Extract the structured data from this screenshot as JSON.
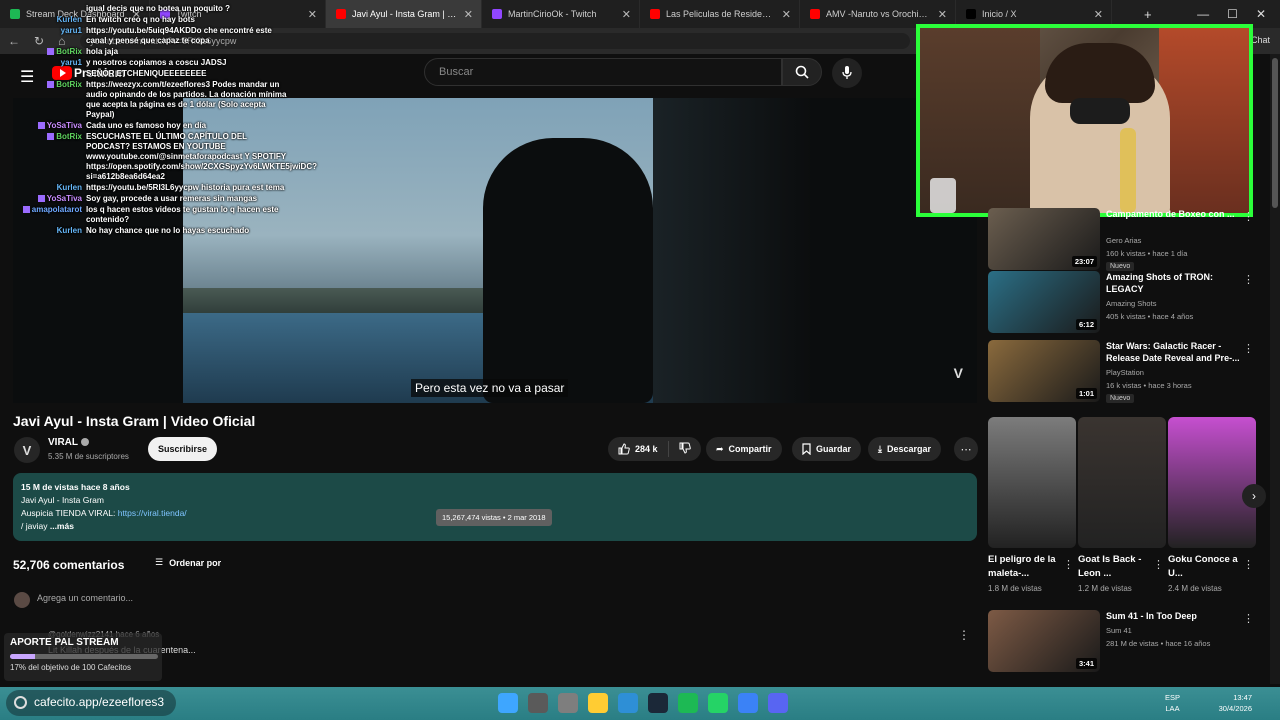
{
  "browser": {
    "tabs": [
      {
        "label": "Stream Deck Dashboard",
        "active": false,
        "fav_color": "#1db954"
      },
      {
        "label": "Twitch",
        "active": false,
        "fav_color": "#9146ff"
      },
      {
        "label": "Javi Ayul - Insta Gram | Video",
        "active": true,
        "fav_color": "#ff0000"
      },
      {
        "label": "MartinCirioOk - Twitch",
        "active": false,
        "fav_color": "#9146ff"
      },
      {
        "label": "Las Peliculas de Resident Evil NO",
        "active": false,
        "fav_color": "#ff0000"
      },
      {
        "label": "AMV -Naruto vs Orochimaru - In",
        "active": false,
        "fav_color": "#ff0000"
      },
      {
        "label": "Inicio / X",
        "active": false,
        "fav_color": "#000000"
      }
    ],
    "url": "youtube.com/watch?v=5RI3L6yycpw",
    "side_label": "Chat"
  },
  "header": {
    "brand": "Premium",
    "search_placeholder": "Buscar"
  },
  "video": {
    "caption": "Pero esta vez no va a pasar",
    "watermark": "V",
    "title": "Javi Ayul - Insta Gram | Video Oficial"
  },
  "channel": {
    "avatar_letter": "V",
    "name": "VIRAL",
    "subs": "5.35 M de suscriptores",
    "subscribe_label": "Suscribirse"
  },
  "actions": {
    "likes": "284 k",
    "share": "Compartir",
    "save": "Guardar",
    "download": "Descargar"
  },
  "description": {
    "meta": "15 M de vistas  hace 8 años",
    "line1": "Javi Ayul - Insta Gram",
    "line2_prefix": "Auspicia TIENDA VIRAL: ",
    "line2_link": "https://viral.tienda/",
    "line3_prefix": "/ javiay",
    "more": "...más",
    "tooltip": "15,267,474 vistas • 2 mar 2018"
  },
  "comments": {
    "count": "52,706 comentarios",
    "sort_label": "Ordenar por",
    "add_placeholder": "Agrega un comentario...",
    "first_user": "@goldenwizz2141  hace 6 años",
    "first_text": "Lit Killah después de la cuarentena..."
  },
  "chat": [
    {
      "user": "",
      "text": "igual decis que no botea un poquito ?",
      "color": "#ffffff",
      "badge": false
    },
    {
      "user": "Kurlen",
      "text": "En twitch creo q no hay bots",
      "color": "#64b5f6",
      "badge": false
    },
    {
      "user": "yaru1",
      "text": "https://youtu.be/5uiq94AKDDo che encontré este canal y pensé que capaz te copa",
      "color": "#64b5f6",
      "badge": false
    },
    {
      "user": "BotRix",
      "text": "hola jaja",
      "color": "#5fd35f",
      "badge": true
    },
    {
      "user": "yaru1",
      "text": "y nosotros copiamos a coscu JADSJ",
      "color": "#64b5f6",
      "badge": false
    },
    {
      "user": "",
      "text": "SEÑOR ETCHENIQUEEEEEEEE",
      "color": "#ffffff",
      "badge": false
    },
    {
      "user": "BotRix",
      "text": "https://weezyx.com/t/ezeeflores3 Podes mandar un audio opinando de los partidos. La donación mínima que acepta la página es de 1 dólar (Solo acepta Paypal)",
      "color": "#5fd35f",
      "badge": true
    },
    {
      "user": "YoSaTiva",
      "text": "Cada uno es famoso hoy en día",
      "color": "#c98cff",
      "badge": true
    },
    {
      "user": "BotRix",
      "text": "ESCUCHASTE EL ÚLTIMO CAPÍTULO DEL PODCAST? ESTAMOS EN YOUTUBE www.youtube.com/@sinmetaforapodcast Y SPOTIFY https://open.spotify.com/show/2CXGSpyzYv6LWKTE5jwiDC?si=a612b8ea6d64ea2",
      "color": "#5fd35f",
      "badge": true
    },
    {
      "user": "Kurlen",
      "text": "https://youtu.be/5RI3L6yycpw historia pura est tema",
      "color": "#64b5f6",
      "badge": false
    },
    {
      "user": "YoSaTiva",
      "text": "Soy gay, procede a usar remeras sin mangas",
      "color": "#c98cff",
      "badge": true
    },
    {
      "user": "amapolatarot",
      "text": "los q hacen estos videos te gustan lo q hacen este contenido?",
      "color": "#6ea8ff",
      "badge": true
    },
    {
      "user": "Kurlen",
      "text": "No hay chance que no lo hayas escuchado",
      "color": "#64b5f6",
      "badge": false
    }
  ],
  "donation": {
    "title": "APORTE PAL STREAM",
    "progress_percent": 17,
    "goal": "17% del objetivo de 100 Cafecitos"
  },
  "recommendations": [
    {
      "title": "Campamento de Boxeo con ...",
      "channel": "Gero Arias",
      "meta": "160 k vistas • hace 1 día",
      "duration": "23:07",
      "badge": "Nuevo",
      "thumb": "#6b5e4f"
    },
    {
      "title": "Amazing Shots of TRON: LEGACY",
      "channel": "Amazing Shots",
      "meta": "405 k vistas • hace 4 años",
      "duration": "6:12",
      "badge": "",
      "thumb": "#2b6f86"
    },
    {
      "title": "Star Wars: Galactic Racer - Release Date Reveal and Pre-...",
      "channel": "PlayStation",
      "meta": "16 k vistas • hace 3 horas",
      "duration": "1:01",
      "badge": "Nuevo",
      "thumb": "#8a6a3d"
    },
    {
      "title": "Sum 41 - In Too Deep",
      "channel": "Sum 41",
      "meta": "281 M de vistas • hace 16 años",
      "duration": "3:41",
      "badge": "",
      "thumb": "#7d5a45"
    }
  ],
  "shorts": [
    {
      "title": "El peligro de la maleta-...",
      "views": "1.8 M de vistas",
      "thumb": "#7c7c7c"
    },
    {
      "title": "Goat Is Back - Leon ...",
      "views": "1.2 M de vistas",
      "thumb": "#3a3430"
    },
    {
      "title": "Goku Conoce a U...",
      "views": "2.4 M de vistas",
      "thumb": "#c64fd0"
    }
  ],
  "taskbar": {
    "search_text": "cafecito.app/ezeeflores3",
    "lang1": "ESP",
    "lang2": "LAA",
    "time": "13:47",
    "date": "30/4/2026",
    "app_colors": [
      "#3ea6ff",
      "#5a5a5a",
      "#7e7e7e",
      "#ffcc33",
      "#2e8fd6",
      "#1b2838",
      "#1db954",
      "#25d366",
      "#3b82f6",
      "#5865f2"
    ]
  },
  "colors": {
    "webcam_border": "#2bff3a",
    "description_bg": "#1c4a47",
    "youtube_red": "#ff0000"
  }
}
